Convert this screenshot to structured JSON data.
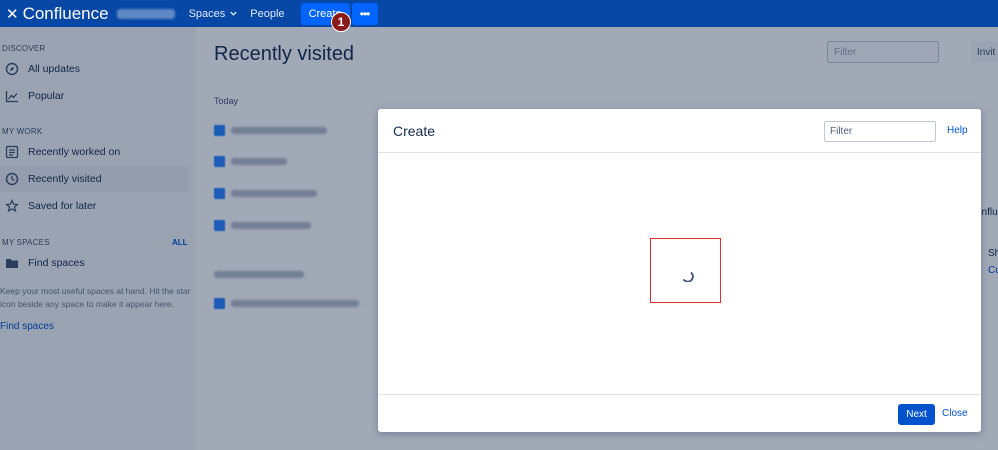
{
  "topnav": {
    "app_name": "Confluence",
    "spaces_label": "Spaces",
    "people_label": "People",
    "create_label": "Create",
    "more_label": "•••",
    "step_badge": "1",
    "colors": {
      "bar": "#0747a6",
      "create": "#0065ff",
      "badge": "#8b1a1a"
    }
  },
  "sidebar": {
    "discover_heading": "DISCOVER",
    "all_updates": "All updates",
    "popular": "Popular",
    "my_work_heading": "MY WORK",
    "recently_worked_on": "Recently worked on",
    "recently_visited": "Recently visited",
    "saved_for_later": "Saved for later",
    "my_spaces_heading": "MY SPACES",
    "all_label": "ALL",
    "find_spaces": "Find spaces",
    "help_text": "Keep your most useful spaces at hand. Hit the star icon beside any space to make it appear here.",
    "find_spaces_link": "Find spaces"
  },
  "main": {
    "title": "Recently visited",
    "filter_placeholder": "Filter",
    "invite_label": "Invit",
    "today_label": "Today",
    "edge_text_1": "onflu",
    "edge_text_2": "Sh",
    "edge_text_3": "Cu"
  },
  "dialog": {
    "title": "Create",
    "filter_placeholder": "Filter",
    "help_label": "Help",
    "next_label": "Next",
    "close_label": "Close",
    "colors": {
      "primary": "#0052cc",
      "highlight": "#d9302c"
    }
  }
}
